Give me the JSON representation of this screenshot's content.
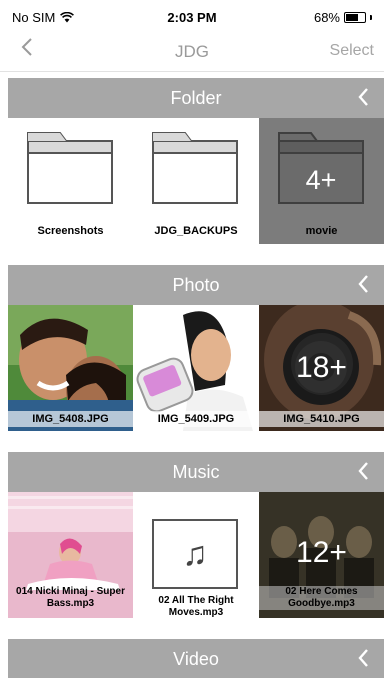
{
  "status_bar": {
    "carrier": "No SIM",
    "time": "2:03 PM",
    "battery_percent": "68%",
    "battery_level": 0.68,
    "wifi_icon": "wifi-icon"
  },
  "nav_bar": {
    "back_glyph": "<",
    "title": "JDG",
    "select_label": "Select"
  },
  "sections": {
    "folder": {
      "title": "Folder",
      "chevron": "<",
      "items": [
        {
          "label": "Screenshots"
        },
        {
          "label": "JDG_BACKUPS"
        },
        {
          "label": "movie",
          "more_count": "4+"
        }
      ]
    },
    "photo": {
      "title": "Photo",
      "chevron": "<",
      "items": [
        {
          "label": "IMG_5408.JPG"
        },
        {
          "label": "IMG_5409.JPG"
        },
        {
          "label": "IMG_5410.JPG",
          "more_count": "18+"
        }
      ]
    },
    "music": {
      "title": "Music",
      "chevron": "<",
      "items": [
        {
          "label": "014 Nicki Minaj - Super Bass.mp3"
        },
        {
          "label": "02 All The Right Moves.mp3",
          "icon": "music-note-icon",
          "glyph": "♫"
        },
        {
          "label": "02 Here Comes Goodbye.mp3",
          "more_count": "12+"
        }
      ]
    },
    "video": {
      "title": "Video",
      "chevron": "<"
    }
  },
  "colors": {
    "section_header": "#a7a7a7",
    "more_overlay": "#7c7c7c",
    "nav_text": "#9a9a9a"
  }
}
